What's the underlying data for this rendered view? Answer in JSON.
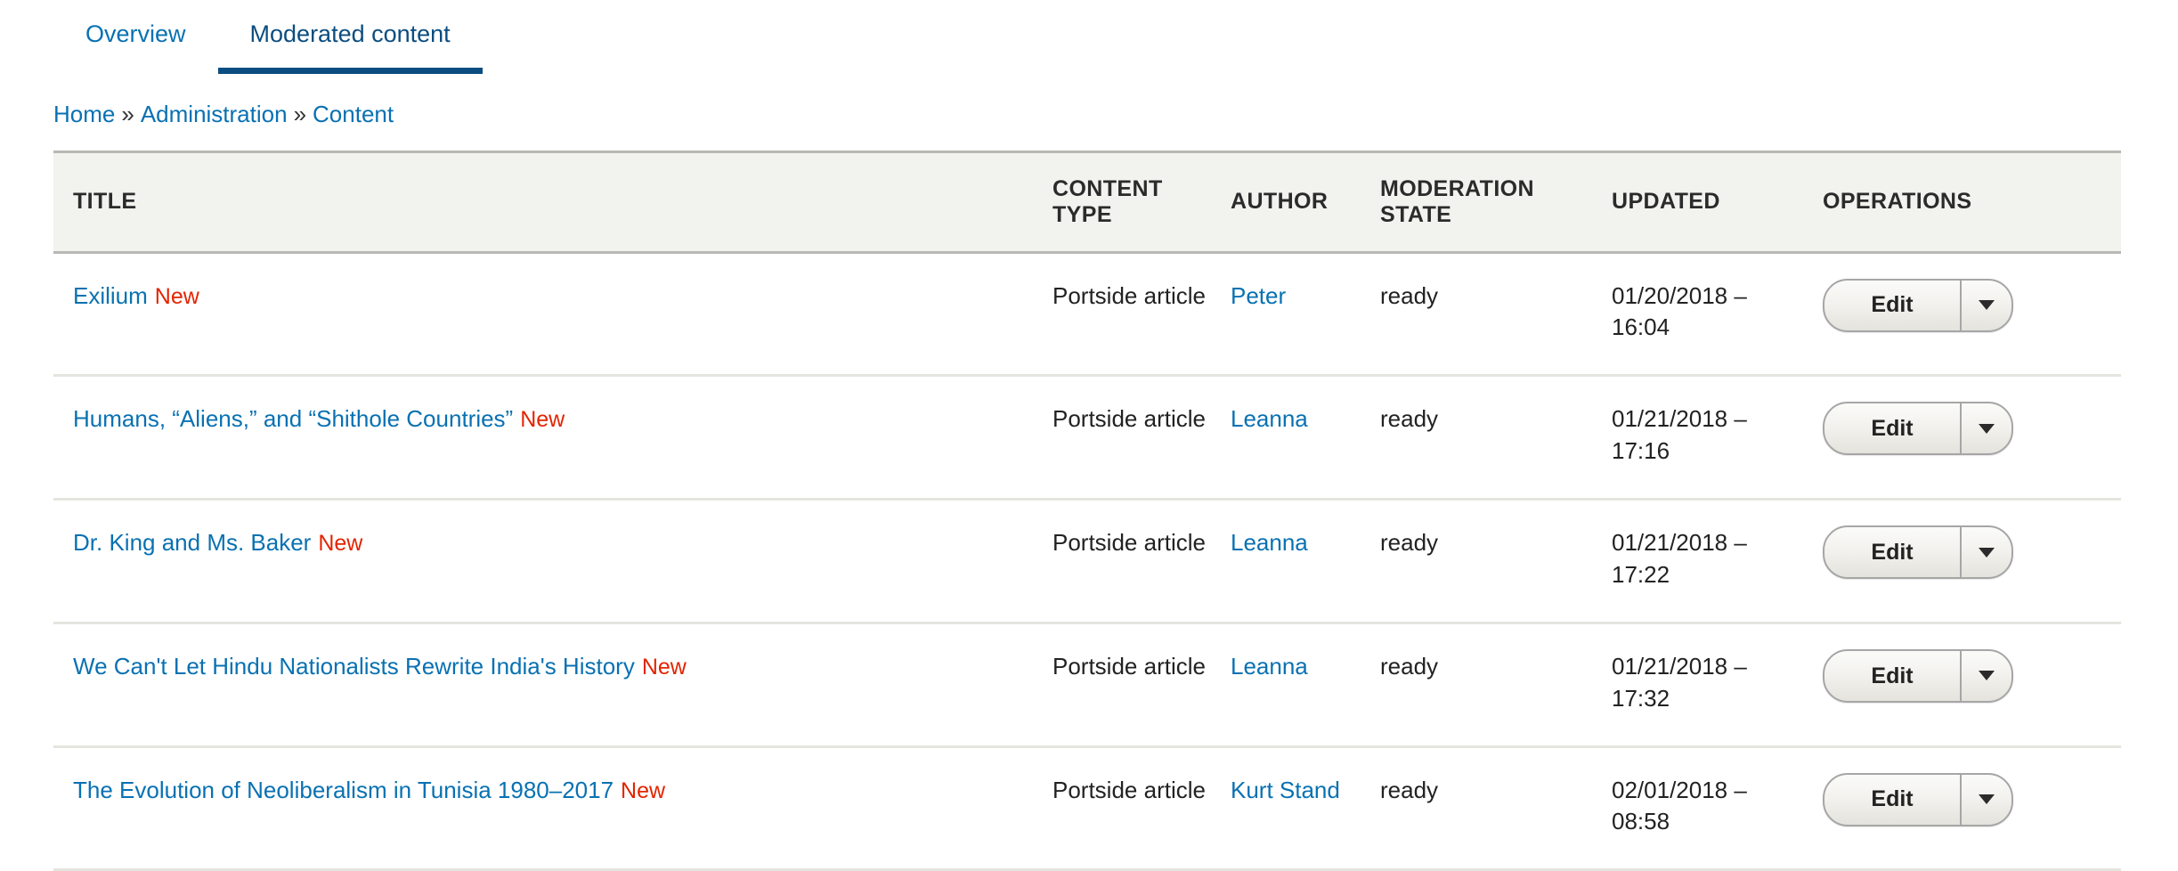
{
  "tabs": [
    {
      "label": "Overview",
      "active": false
    },
    {
      "label": "Moderated content",
      "active": true
    }
  ],
  "breadcrumb": {
    "items": [
      "Home",
      "Administration",
      "Content"
    ],
    "separator": "»"
  },
  "table": {
    "columns": [
      "TITLE",
      "CONTENT TYPE",
      "AUTHOR",
      "MODERATION STATE",
      "UPDATED",
      "OPERATIONS"
    ],
    "rows": [
      {
        "title": "Exilium",
        "marker": "New",
        "content_type": "Portside article",
        "author": "Peter",
        "moderation_state": "ready",
        "updated": "01/20/2018 – 16:04",
        "operations": {
          "primary": "Edit",
          "toggle_icon": "chevron-down-icon"
        }
      },
      {
        "title": "Humans, “Aliens,” and “Shithole Countries”",
        "marker": "New",
        "content_type": "Portside article",
        "author": "Leanna",
        "moderation_state": "ready",
        "updated": "01/21/2018 – 17:16",
        "operations": {
          "primary": "Edit",
          "toggle_icon": "chevron-down-icon"
        }
      },
      {
        "title": "Dr. King and Ms. Baker",
        "marker": "New",
        "content_type": "Portside article",
        "author": "Leanna",
        "moderation_state": "ready",
        "updated": "01/21/2018 – 17:22",
        "operations": {
          "primary": "Edit",
          "toggle_icon": "chevron-down-icon"
        }
      },
      {
        "title": "We Can't Let Hindu Nationalists Rewrite India's History",
        "marker": "New",
        "content_type": "Portside article",
        "author": "Leanna",
        "moderation_state": "ready",
        "updated": "01/21/2018 – 17:32",
        "operations": {
          "primary": "Edit",
          "toggle_icon": "chevron-down-icon"
        }
      },
      {
        "title": "The Evolution of Neoliberalism in Tunisia 1980–2017",
        "marker": "New",
        "content_type": "Portside article",
        "author": "Kurt Stand",
        "moderation_state": "ready",
        "updated": "02/01/2018 – 08:58",
        "operations": {
          "primary": "Edit",
          "toggle_icon": "chevron-down-icon"
        }
      }
    ]
  },
  "colors": {
    "link": "#0971b2",
    "active_tab": "#0b4d80",
    "new_marker": "#e32400",
    "table_header_bg": "#f2f2ee"
  }
}
